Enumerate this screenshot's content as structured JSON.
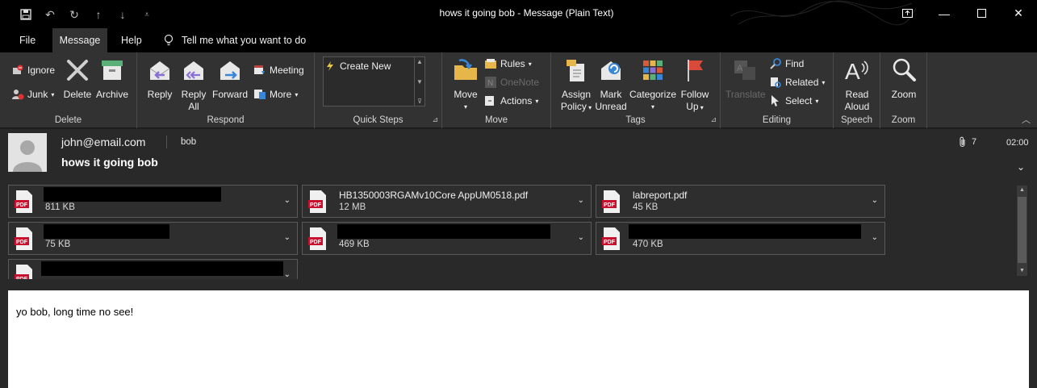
{
  "window": {
    "title": "hows it going bob  -  Message (Plain Text)"
  },
  "menu": {
    "tabs": [
      "File",
      "Message",
      "Help"
    ],
    "active_tab": "Message",
    "tell_me": "Tell me what you want to do"
  },
  "ribbon": {
    "delete": {
      "ignore": "Ignore",
      "junk": "Junk",
      "delete": "Delete",
      "archive": "Archive",
      "label": "Delete"
    },
    "respond": {
      "reply": "Reply",
      "reply_all_1": "Reply",
      "reply_all_2": "All",
      "forward": "Forward",
      "meeting": "Meeting",
      "more": "More",
      "label": "Respond"
    },
    "quick_steps": {
      "create_new": "Create New",
      "label": "Quick Steps"
    },
    "move": {
      "move": "Move",
      "rules": "Rules",
      "onenote": "OneNote",
      "actions": "Actions",
      "label": "Move"
    },
    "tags": {
      "assign_1": "Assign",
      "assign_2": "Policy",
      "mark_1": "Mark",
      "mark_2": "Unread",
      "categorize": "Categorize",
      "follow_1": "Follow",
      "follow_2": "Up",
      "label": "Tags"
    },
    "editing": {
      "translate": "Translate",
      "find": "Find",
      "related": "Related",
      "select": "Select",
      "label": "Editing"
    },
    "speech": {
      "read_1": "Read",
      "read_2": "Aloud",
      "label": "Speech"
    },
    "zoom": {
      "zoom": "Zoom",
      "label": "Zoom"
    }
  },
  "header": {
    "from": "john@email.com",
    "to": "bob",
    "subject": "hows it going bob",
    "attachment_count": "7",
    "time": "02:00"
  },
  "attachments": [
    {
      "name": "",
      "size": "811 KB"
    },
    {
      "name": "HB1350003RGAMv10Core AppUM0518.pdf",
      "size": "12 MB"
    },
    {
      "name": "labreport.pdf",
      "size": "45 KB"
    },
    {
      "name": "",
      "size": "75 KB"
    },
    {
      "name": "",
      "size": "469 KB"
    },
    {
      "name": "",
      "size": "470 KB"
    },
    {
      "name": "",
      "size": ""
    }
  ],
  "body": {
    "text": "yo bob, long time no see!"
  },
  "colors": {
    "background": "#1e1e1e",
    "ribbon": "#323232",
    "titlebar": "#000000",
    "pdf_red": "#c8102e"
  }
}
